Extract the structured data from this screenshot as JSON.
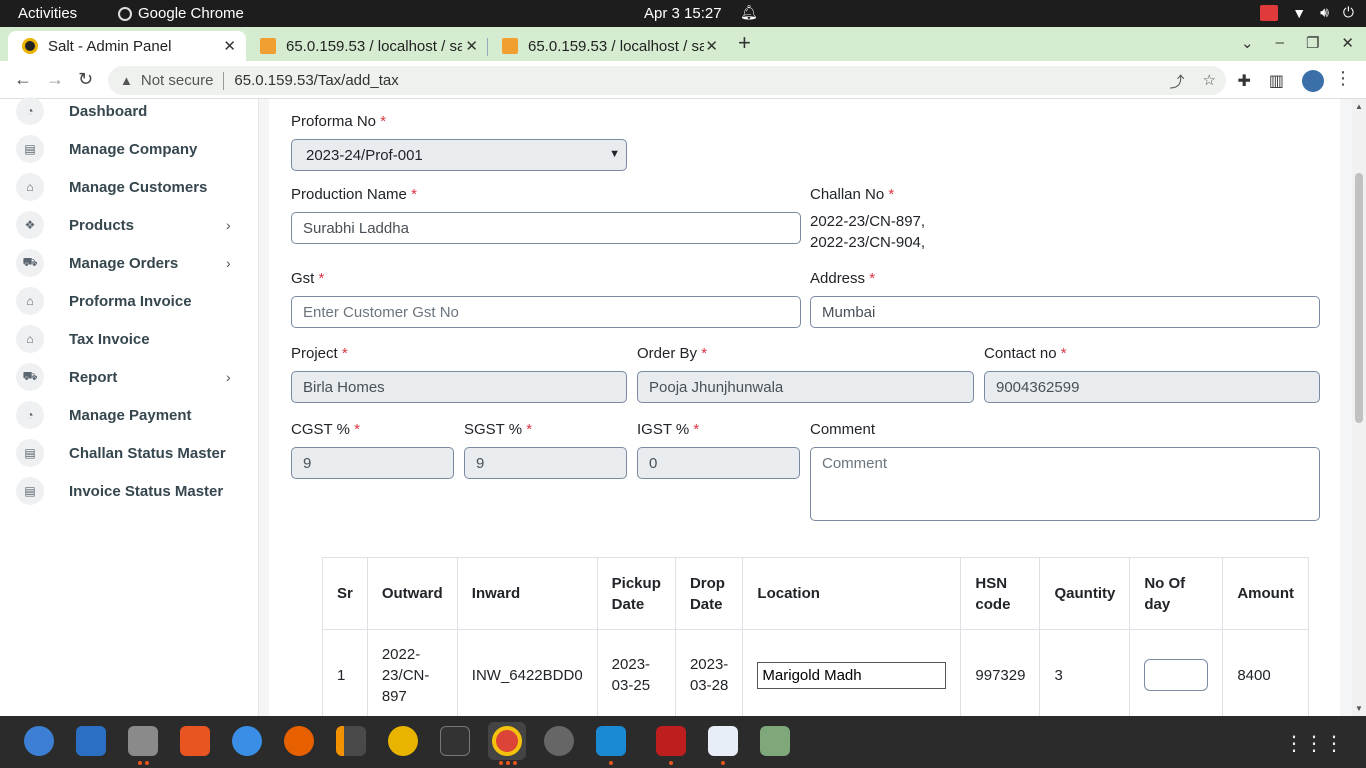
{
  "system": {
    "activities": "Activities",
    "app_name": "Google Chrome",
    "clock": "Apr 3  15:27"
  },
  "browser": {
    "tabs": [
      {
        "title": "Salt - Admin Panel",
        "active": true
      },
      {
        "title": "65.0.159.53 / localhost / sa",
        "active": false
      },
      {
        "title": "65.0.159.53 / localhost / sa",
        "active": false
      }
    ],
    "security": "Not secure",
    "url": "65.0.159.53/Tax/add_tax"
  },
  "sidebar": {
    "items": [
      {
        "label": "Dashboard",
        "icon": "gauge-icon",
        "has_submenu": false
      },
      {
        "label": "Manage Company",
        "icon": "building-icon",
        "has_submenu": false
      },
      {
        "label": "Manage Customers",
        "icon": "store-icon",
        "has_submenu": false
      },
      {
        "label": "Products",
        "icon": "boxes-icon",
        "has_submenu": true
      },
      {
        "label": "Manage Orders",
        "icon": "truck-icon",
        "has_submenu": true
      },
      {
        "label": "Proforma Invoice",
        "icon": "store-icon",
        "has_submenu": false
      },
      {
        "label": "Tax Invoice",
        "icon": "store-icon",
        "has_submenu": false
      },
      {
        "label": "Report",
        "icon": "truck-icon",
        "has_submenu": true
      },
      {
        "label": "Manage Payment",
        "icon": "gauge-icon",
        "has_submenu": false
      },
      {
        "label": "Challan Status Master",
        "icon": "building-icon",
        "has_submenu": false
      },
      {
        "label": "Invoice Status Master",
        "icon": "building-icon",
        "has_submenu": false
      }
    ]
  },
  "form": {
    "proforma_no": {
      "label": "Proforma No",
      "value": "2023-24/Prof-001"
    },
    "production_name": {
      "label": "Production Name",
      "value": "Surabhi Laddha"
    },
    "challan_no": {
      "label": "Challan No",
      "values": [
        "2022-23/CN-897,",
        "2022-23/CN-904,"
      ]
    },
    "gst": {
      "label": "Gst",
      "placeholder": "Enter Customer Gst No"
    },
    "address": {
      "label": "Address",
      "value": "Mumbai"
    },
    "project": {
      "label": "Project",
      "value": "Birla Homes"
    },
    "order_by": {
      "label": "Order By",
      "value": "Pooja Jhunjhunwala"
    },
    "contact_no": {
      "label": "Contact no",
      "value": "9004362599"
    },
    "cgst": {
      "label": "CGST %",
      "value": "9"
    },
    "sgst": {
      "label": "SGST %",
      "value": "9"
    },
    "igst": {
      "label": "IGST %",
      "value": "0"
    },
    "comment": {
      "label": "Comment",
      "placeholder": "Comment"
    },
    "required_mark": "*"
  },
  "table": {
    "headers": [
      "Sr",
      "Outward",
      "Inward",
      "Pickup Date",
      "Drop Date",
      "Location",
      "HSN code",
      "Qauntity",
      "No Of day",
      "Amount"
    ],
    "rows": [
      {
        "sr": "1",
        "outward": "2022-23/CN-897",
        "inward": "INW_6422BDD0",
        "pickup": "2023-03-25",
        "drop": "2023-03-28",
        "location": "Marigold Madh",
        "hsn": "997329",
        "qty": "3",
        "days": "",
        "amount": "8400"
      }
    ]
  },
  "dock": {
    "apps": [
      "thunderbird-icon",
      "writer-icon",
      "files-icon",
      "app-center-icon",
      "help-icon",
      "firefox-icon",
      "sublime-icon",
      "rhythmbox-icon",
      "terminal-icon",
      "chrome-icon",
      "inkscape-icon",
      "vscode-icon",
      "filezilla-icon",
      "text-editor-icon",
      "trash-icon"
    ]
  }
}
